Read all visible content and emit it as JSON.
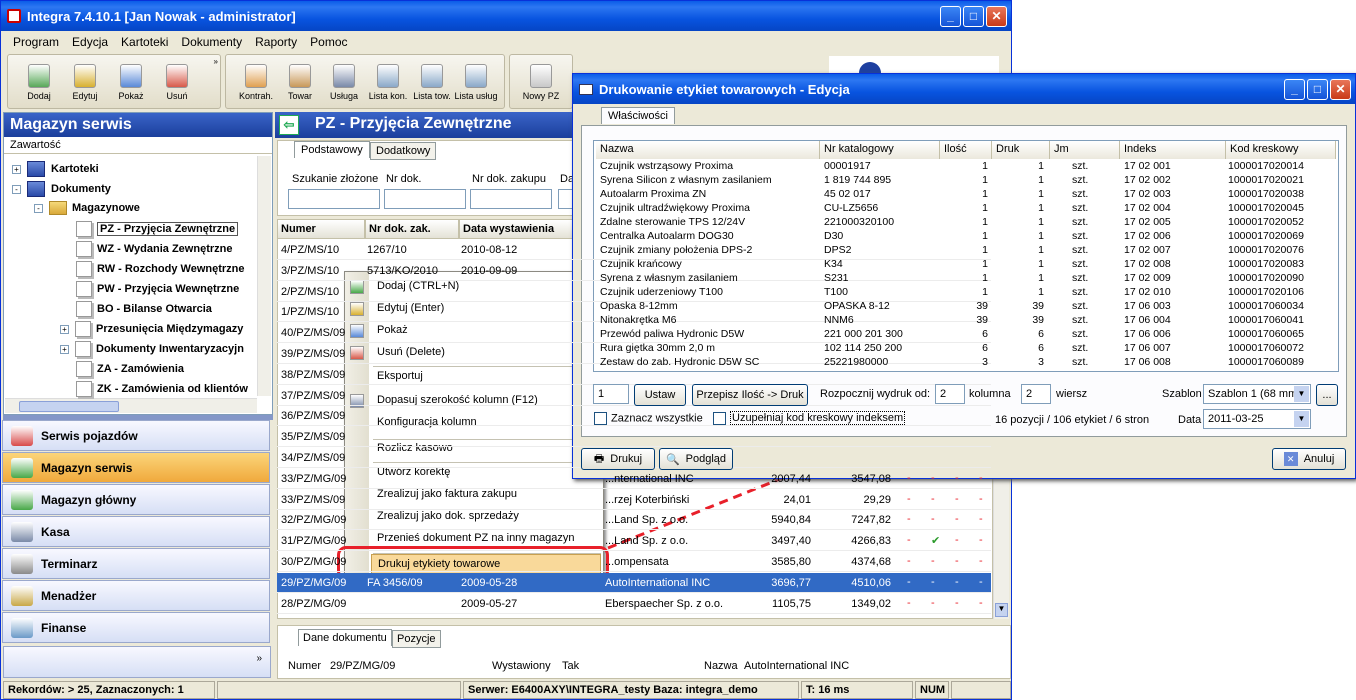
{
  "window": {
    "title": "Integra 7.4.10.1  [Jan Nowak - administrator]"
  },
  "menu": [
    "Program",
    "Edycja",
    "Kartoteki",
    "Dokumenty",
    "Raporty",
    "Pomoc"
  ],
  "toolbar1": [
    "Dodaj",
    "Edytuj",
    "Pokaż",
    "Usuń"
  ],
  "toolbar2": [
    "Kontrah.",
    "Towar",
    "Usługa",
    "Lista kon.",
    "Lista tow.",
    "Lista usług"
  ],
  "toolbar3": [
    "Nowy PZ"
  ],
  "left": {
    "title": "Magazyn serwis",
    "subtitle": "Zawartość",
    "tree": [
      "Kartoteki",
      "Dokumenty",
      "Magazynowe",
      "PZ - Przyjęcia Zewnętrzne",
      "WZ - Wydania Zewnętrzne",
      "RW - Rozchody Wewnętrzne",
      "PW - Przyjęcia Wewnętrzne",
      "BO - Bilanse Otwarcia",
      "Przesunięcia Międzymagazy",
      "Dokumenty Inwentaryzacyjn",
      "ZA - Zamówienia",
      "ZK - Zamówienia od klientów"
    ],
    "nav": [
      "Serwis pojazdów",
      "Magazyn serwis",
      "Magazyn główny",
      "Kasa",
      "Terminarz",
      "Menadżer",
      "Finanse"
    ]
  },
  "doc": {
    "title": "PZ - Przyjęcia Zewnętrzne",
    "tabs": [
      "Podstawowy",
      "Dodatkowy"
    ],
    "filters": [
      "Szukanie złożone",
      "Nr dok.",
      "Nr dok. zakupu",
      "Dat"
    ],
    "columns": [
      "Numer",
      "Nr dok. zak.",
      "Data wystawienia"
    ],
    "bottom_tabs": [
      "Dane dokumentu",
      "Pozycje"
    ],
    "details": {
      "numer_label": "Numer",
      "numer": "29/PZ/MG/09",
      "wyst_label": "Wystawiony",
      "wyst": "Tak",
      "nazwa_label": "Nazwa",
      "nazwa": "AutoInternational INC"
    }
  },
  "rows": [
    {
      "nr": "4/PZ/MS/10",
      "zak": "1267/10",
      "data": "2010-08-12"
    },
    {
      "nr": "3/PZ/MS/10",
      "zak": "5713/KO/2010",
      "data": "2010-09-09"
    },
    {
      "nr": "2/PZ/MS/10",
      "zak": "",
      "data": ""
    },
    {
      "nr": "1/PZ/MS/10",
      "zak": "",
      "data": ""
    },
    {
      "nr": "40/PZ/MS/09",
      "zak": "",
      "data": ""
    },
    {
      "nr": "39/PZ/MS/09",
      "zak": "",
      "data": ""
    },
    {
      "nr": "38/PZ/MS/09",
      "zak": "",
      "data": ""
    },
    {
      "nr": "37/PZ/MS/09",
      "zak": "",
      "data": ""
    },
    {
      "nr": "36/PZ/MS/09",
      "zak": "",
      "data": ""
    },
    {
      "nr": "35/PZ/MS/09",
      "zak": "",
      "data": ""
    },
    {
      "nr": "34/PZ/MS/09",
      "zak": "",
      "data": ""
    },
    {
      "nr": "33/PZ/MG/09",
      "zak": "",
      "data": "",
      "name": "...nternational INC",
      "net": "2007,44",
      "gross": "3547,08"
    },
    {
      "nr": "33/PZ/MS/09",
      "zak": "",
      "data": "",
      "name": "...rzej Koterbiński",
      "net": "24,01",
      "gross": "29,29"
    },
    {
      "nr": "32/PZ/MG/09",
      "zak": "",
      "data": "",
      "name": "...Land Sp. z o.o.",
      "net": "5940,84",
      "gross": "7247,82"
    },
    {
      "nr": "31/PZ/MG/09",
      "zak": "",
      "data": "",
      "name": "...Land Sp. z o.o.",
      "net": "3497,40",
      "gross": "4266,83"
    },
    {
      "nr": "30/PZ/MG/09",
      "zak": "",
      "data": "",
      "name": "...ompensata",
      "net": "3585,80",
      "gross": "4374,68"
    },
    {
      "nr": "29/PZ/MG/09",
      "zak": "FA 3456/09",
      "data": "2009-05-28",
      "name": "AutoInternational INC",
      "net": "3696,77",
      "gross": "4510,06"
    },
    {
      "nr": "28/PZ/MG/09",
      "zak": "",
      "data": "2009-05-27",
      "name": "Eberspaecher Sp. z o.o.",
      "net": "1105,75",
      "gross": "1349,02"
    }
  ],
  "context_menu": [
    "Dodaj (CTRL+N)",
    "Edytuj (Enter)",
    "Pokaż",
    "Usuń (Delete)",
    "Eksportuj",
    "Dopasuj szerokość kolumn (F12)",
    "Konfiguracja kolumn",
    "Rozlicz kasowo",
    "Utwórz korektę",
    "Zrealizuj jako faktura zakupu",
    "Zrealizuj jako dok. sprzedaży",
    "Przenieś dokument PZ na inny magazyn",
    "Drukuj etykiety towarowe"
  ],
  "dialog": {
    "title": "Drukowanie etykiet towarowych - Edycja",
    "tab": "Właściwości",
    "columns": [
      "Nazwa",
      "Nr katalogowy",
      "Ilość",
      "Druk",
      "Jm",
      "Indeks",
      "Kod kreskowy"
    ],
    "items": [
      [
        "Czujnik wstrząsowy Proxima",
        "00001917",
        "1",
        "1",
        "szt.",
        "17 02 001",
        "1000017020014"
      ],
      [
        "Syrena Silicon z własnym zasilaniem",
        "1 819 744 895",
        "1",
        "1",
        "szt.",
        "17 02 002",
        "1000017020021"
      ],
      [
        "Autoalarm Proxima ZN",
        "45 02 017",
        "1",
        "1",
        "szt.",
        "17 02 003",
        "1000017020038"
      ],
      [
        "Czujnik ultradźwiękowy Proxima",
        "CU-LZ5656",
        "1",
        "1",
        "szt.",
        "17 02 004",
        "1000017020045"
      ],
      [
        "Zdalne sterowanie TPS 12/24V",
        "221000320100",
        "1",
        "1",
        "szt.",
        "17 02 005",
        "1000017020052"
      ],
      [
        "Centralka Autoalarm DOG30",
        "D30",
        "1",
        "1",
        "szt.",
        "17 02 006",
        "1000017020069"
      ],
      [
        "Czujnik zmiany położenia DPS-2",
        "DPS2",
        "1",
        "1",
        "szt.",
        "17 02 007",
        "1000017020076"
      ],
      [
        "Czujnik krańcowy",
        "K34",
        "1",
        "1",
        "szt.",
        "17 02 008",
        "1000017020083"
      ],
      [
        "Syrena z własnym zasilaniem",
        "S231",
        "1",
        "1",
        "szt.",
        "17 02 009",
        "1000017020090"
      ],
      [
        "Czujnik uderzeniowy T100",
        "T100",
        "1",
        "1",
        "szt.",
        "17 02 010",
        "1000017020106"
      ],
      [
        "Opaska 8-12mm",
        "OPASKA 8-12",
        "39",
        "39",
        "szt.",
        "17 06 003",
        "1000017060034"
      ],
      [
        "Nitonakrętka M6",
        "NNM6",
        "39",
        "39",
        "szt.",
        "17 06 004",
        "1000017060041"
      ],
      [
        "Przewód paliwa Hydronic D5W",
        "221 000 201 300",
        "6",
        "6",
        "szt.",
        "17 06 006",
        "1000017060065"
      ],
      [
        "Rura giętka 30mm 2,0 m",
        "102 114 250 200",
        "6",
        "6",
        "szt.",
        "17 06 007",
        "1000017060072"
      ],
      [
        "Zestaw do zab. Hydronic D5W SC",
        "25221980000",
        "3",
        "3",
        "szt.",
        "17 06 008",
        "1000017060089"
      ]
    ],
    "qty": "1",
    "btn_ustaw": "Ustaw",
    "btn_przepisz": "Przepisz Ilość -> Druk",
    "start_label": "Rozpocznij wydruk od:",
    "col_val": "2",
    "col_label": "kolumna",
    "row_val": "2",
    "row_label": "wiersz",
    "szablon_label": "Szablon",
    "szablon_val": "Szablon 1 (68 mm",
    "more": "...",
    "zaznacz": "Zaznacz wszystkie",
    "uzupelniaj": "Uzupełniaj kod kreskowy indeksem",
    "summary": "16 pozycji / 106 etykiet / 6 stron",
    "data_label": "Data",
    "data_val": "2011-03-25",
    "btn_drukuj": "Drukuj",
    "btn_podglad": "Podgląd",
    "btn_anuluj": "Anuluj"
  },
  "status": [
    "Rekordów: > 25, Zaznaczonych: 1",
    "Serwer: E6400AXY\\INTEGRA_testy  Baza: integra_demo",
    "T: 16 ms",
    "NUM"
  ],
  "colors": {
    "title_blue": "#0a5ce8",
    "highlight": "#e8202a",
    "selection": "#316ac5"
  }
}
